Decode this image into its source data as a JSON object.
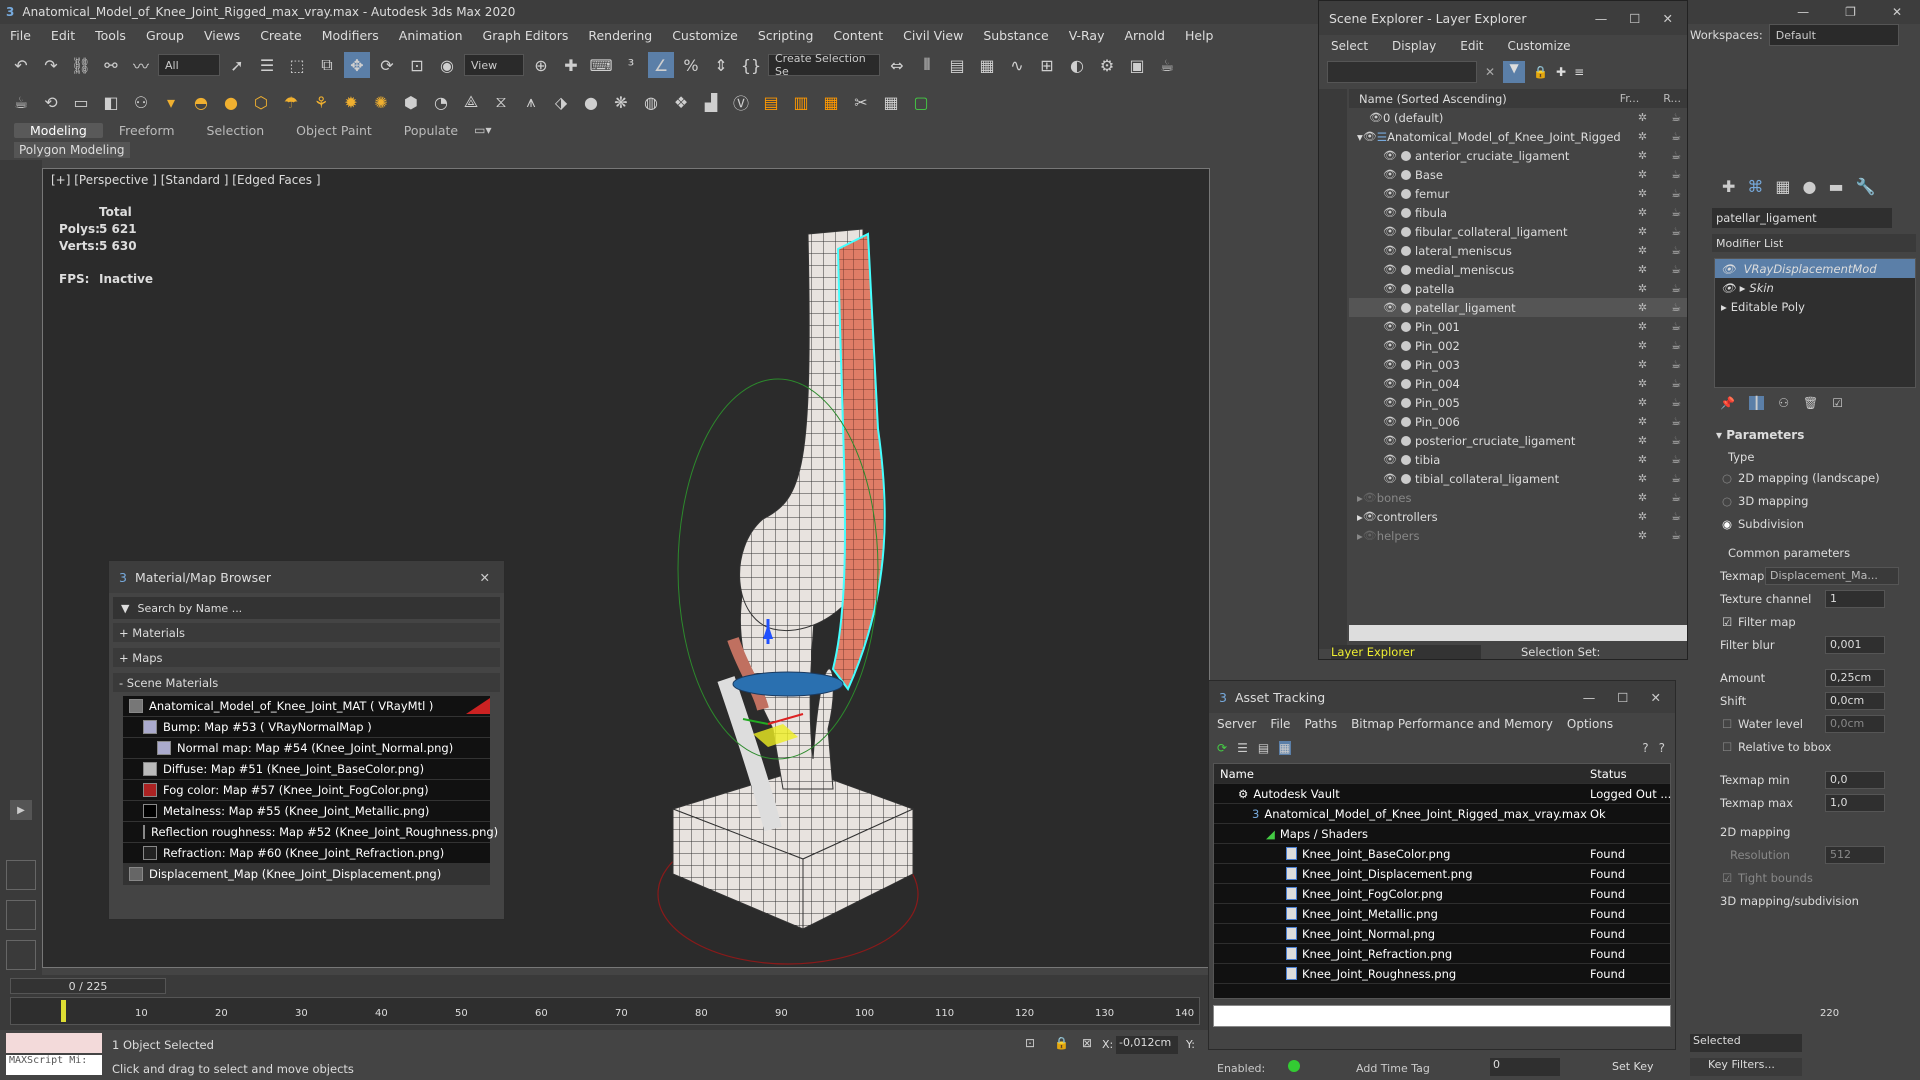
{
  "window": {
    "title": "Anatomical_Model_of_Knee_Joint_Rigged_max_vray.max - Autodesk 3ds Max 2020"
  },
  "menu": [
    "File",
    "Edit",
    "Tools",
    "Group",
    "Views",
    "Create",
    "Modifiers",
    "Animation",
    "Graph Editors",
    "Rendering",
    "Customize",
    "Scripting",
    "Content",
    "Civil View",
    "Substance",
    "V-Ray",
    "Arnold",
    "Help"
  ],
  "workspaces": {
    "label": "Workspaces:",
    "value": "Default"
  },
  "toolbar": {
    "filter": "All",
    "view": "View",
    "selection_set": "Create Selection Se"
  },
  "ribbon": {
    "tabs": [
      "Modeling",
      "Freeform",
      "Selection",
      "Object Paint",
      "Populate"
    ],
    "sub": "Polygon Modeling"
  },
  "viewport": {
    "label": "[+] [Perspective ] [Standard ] [Edged Faces ]",
    "total": "Total",
    "polys_label": "Polys:",
    "polys": "5 621",
    "verts_label": "Verts:",
    "verts": "5 630",
    "fps_label": "FPS:",
    "fps": "Inactive"
  },
  "scene_explorer": {
    "title": "Scene Explorer - Layer Explorer",
    "menu": [
      "Select",
      "Display",
      "Edit",
      "Customize"
    ],
    "col_name": "Name (Sorted Ascending)",
    "col_fr": "Fr...",
    "col_r": "R...",
    "rows": [
      "0 (default)",
      "Anatomical_Model_of_Knee_Joint_Rigged",
      "anterior_cruciate_ligament",
      "Base",
      "femur",
      "fibula",
      "fibular_collateral_ligament",
      "lateral_meniscus",
      "medial_meniscus",
      "patella",
      "patellar_ligament",
      "Pin_001",
      "Pin_002",
      "Pin_003",
      "Pin_004",
      "Pin_005",
      "Pin_006",
      "posterior_cruciate_ligament",
      "tibia",
      "tibial_collateral_ligament",
      "bones",
      "controllers",
      "helpers"
    ],
    "footer_left": "Layer Explorer",
    "footer_right": "Selection Set:"
  },
  "cmd": {
    "object_name": "patellar_ligament",
    "modifier_list": "Modifier List",
    "stack": [
      "VRayDisplacementMod",
      "Skin",
      "Editable Poly"
    ],
    "parameters": "Parameters",
    "type": "Type",
    "types": [
      "2D mapping (landscape)",
      "3D mapping",
      "Subdivision"
    ],
    "common": "Common parameters",
    "texmap_label": "Texmap",
    "texmap": "Displacement_Ma...",
    "texchan_label": "Texture channel",
    "texchan": "1",
    "filter_map": "Filter map",
    "filter_blur_label": "Filter blur",
    "filter_blur": "0,001",
    "amount_label": "Amount",
    "amount": "0,25cm",
    "shift_label": "Shift",
    "shift": "0,0cm",
    "water_label": "Water level",
    "water": "0,0cm",
    "rel_bbox": "Relative to bbox",
    "tmin_label": "Texmap min",
    "tmin": "0,0",
    "tmax_label": "Texmap max",
    "tmax": "1,0",
    "map2d": "2D mapping",
    "res_label": "Resolution",
    "res": "512",
    "tight": "Tight bounds",
    "map3d": "3D mapping/subdivision"
  },
  "mat_browser": {
    "title": "Material/Map Browser",
    "search": "Search by Name ...",
    "sections": [
      "+ Materials",
      "+ Maps",
      "- Scene Materials"
    ],
    "items": [
      "Anatomical_Model_of_Knee_Joint_MAT ( VRayMtl )",
      "Bump: Map #53  ( VRayNormalMap )",
      "Normal map: Map #54 (Knee_Joint_Normal.png)",
      "Diffuse: Map #51 (Knee_Joint_BaseColor.png)",
      "Fog color: Map #57 (Knee_Joint_FogColor.png)",
      "Metalness: Map #55 (Knee_Joint_Metallic.png)",
      "Reflection roughness: Map #52 (Knee_Joint_Roughness.png)",
      "Refraction: Map #60 (Knee_Joint_Refraction.png)",
      "Displacement_Map (Knee_Joint_Displacement.png)"
    ]
  },
  "asset": {
    "title": "Asset Tracking",
    "menu": [
      "Server",
      "File",
      "Paths",
      "Bitmap Performance and Memory",
      "Options"
    ],
    "col_name": "Name",
    "col_status": "Status",
    "rows": [
      {
        "name": "Autodesk Vault",
        "status": "Logged Out ..."
      },
      {
        "name": "Anatomical_Model_of_Knee_Joint_Rigged_max_vray.max",
        "status": "Ok"
      },
      {
        "name": "Maps / Shaders",
        "status": ""
      },
      {
        "name": "Knee_Joint_BaseColor.png",
        "status": "Found"
      },
      {
        "name": "Knee_Joint_Displacement.png",
        "status": "Found"
      },
      {
        "name": "Knee_Joint_FogColor.png",
        "status": "Found"
      },
      {
        "name": "Knee_Joint_Metallic.png",
        "status": "Found"
      },
      {
        "name": "Knee_Joint_Normal.png",
        "status": "Found"
      },
      {
        "name": "Knee_Joint_Refraction.png",
        "status": "Found"
      },
      {
        "name": "Knee_Joint_Roughness.png",
        "status": "Found"
      }
    ]
  },
  "timeline": {
    "frame": "0 / 225",
    "ticks": [
      "10",
      "20",
      "30",
      "40",
      "50",
      "60",
      "70",
      "80",
      "90",
      "100",
      "110",
      "120",
      "130",
      "140",
      "220"
    ]
  },
  "status": {
    "script": "MAXScript Mi:",
    "selected": "1 Object Selected",
    "hint": "Click and drag to select and move objects",
    "x_label": "X:",
    "x": "-0,012cm",
    "y_label": "Y:",
    "enabled": "Enabled:",
    "add_time_tag": "Add Time Tag",
    "frame_val": "0",
    "set_key": "Set Key",
    "key_filters": "Key Filters...",
    "selected_dd": "Selected"
  }
}
